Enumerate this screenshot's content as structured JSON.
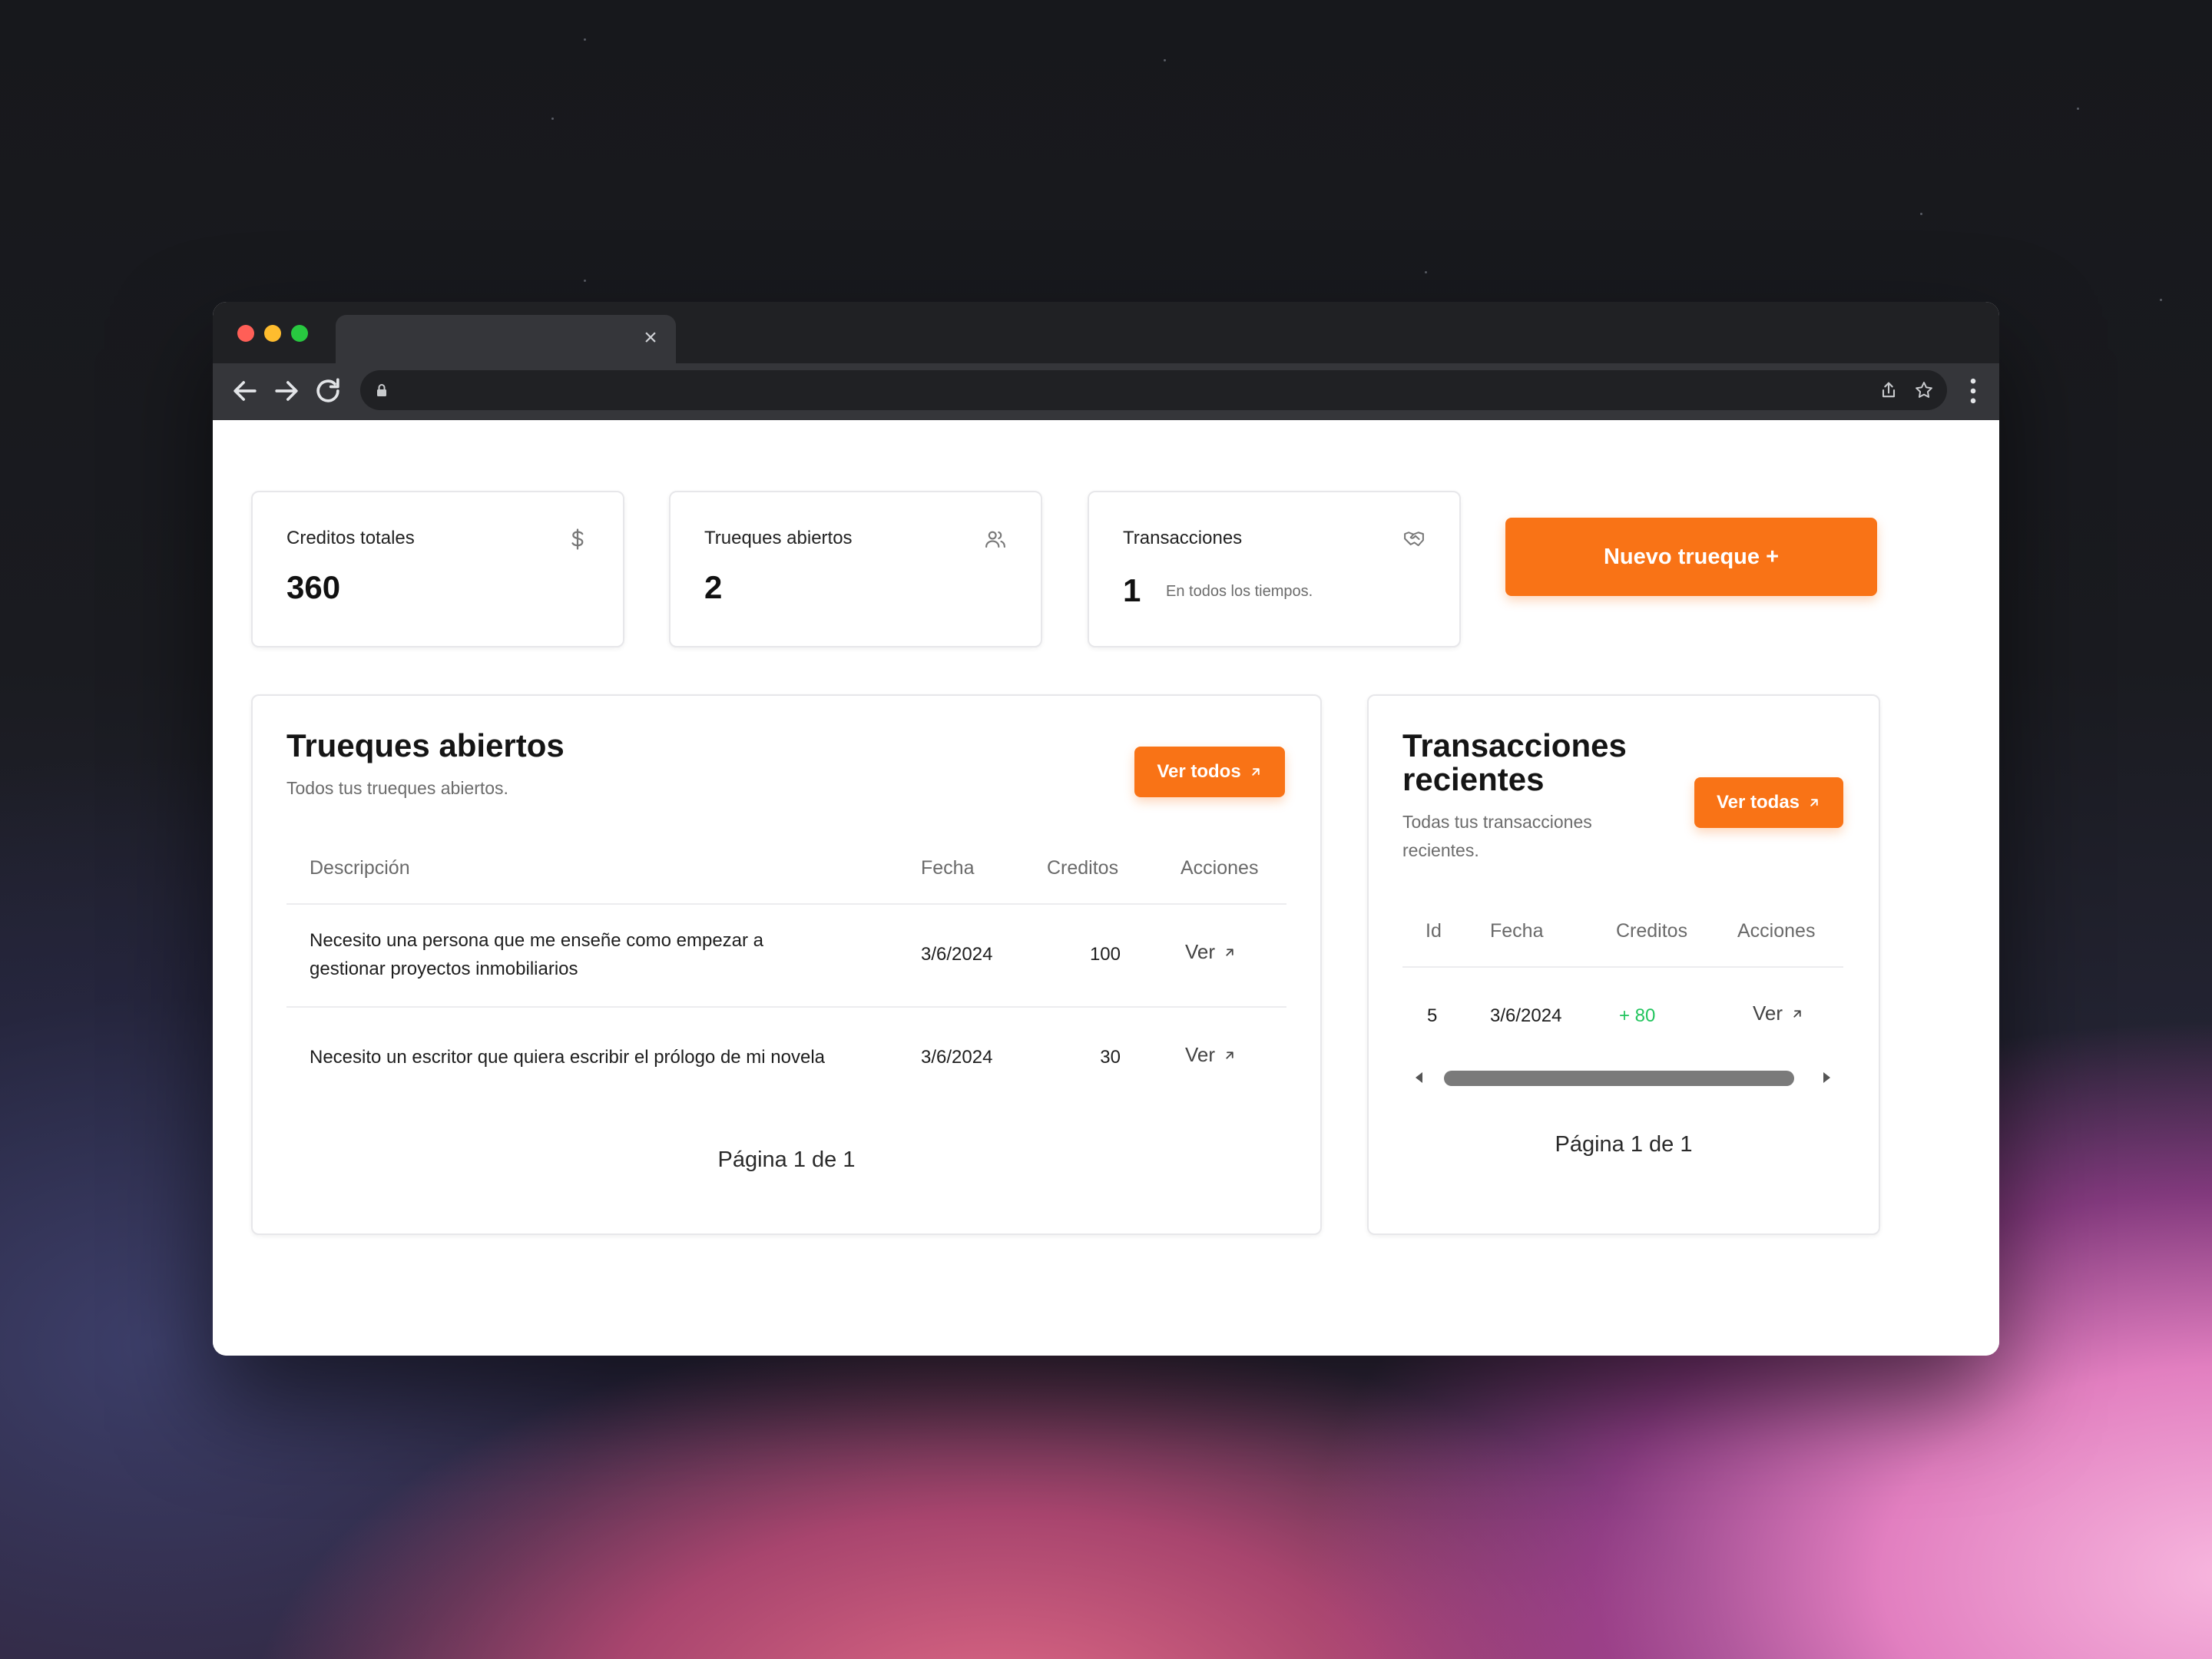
{
  "browser": {
    "tab_close": "×"
  },
  "stats": [
    {
      "label": "Creditos totales",
      "value": "360",
      "icon": "dollar-icon"
    },
    {
      "label": "Trueques abiertos",
      "value": "2",
      "icon": "users-icon"
    },
    {
      "label": "Transacciones",
      "value": "1",
      "note": "En todos los tiempos.",
      "icon": "handshake-icon"
    }
  ],
  "new_trade_button": "Nuevo trueque +",
  "open_trades": {
    "title": "Trueques abiertos",
    "subtitle": "Todos tus trueques abiertos.",
    "see_all": "Ver todos",
    "columns": [
      "Descripción",
      "Fecha",
      "Creditos",
      "Acciones"
    ],
    "rows": [
      {
        "description": "Necesito una persona que me enseñe como empezar a gestionar proyectos inmobiliarios",
        "date": "3/6/2024",
        "credits": "100",
        "action": "Ver"
      },
      {
        "description": "Necesito un escritor que quiera escribir el prólogo de mi novela",
        "date": "3/6/2024",
        "credits": "30",
        "action": "Ver"
      }
    ],
    "pager": "Página 1 de 1"
  },
  "recent_transactions": {
    "title_line1": "Transacciones",
    "title_line2": "recientes",
    "subtitle_line1": "Todas tus transacciones",
    "subtitle_line2": "recientes.",
    "see_all": "Ver todas",
    "columns": [
      "Id",
      "Fecha",
      "Creditos",
      "Acciones"
    ],
    "rows": [
      {
        "id": "5",
        "date": "3/6/2024",
        "credits": "+ 80",
        "action": "Ver"
      }
    ],
    "pager": "Página 1 de 1"
  },
  "colors": {
    "accent": "#f97316",
    "positive": "#22c55e"
  }
}
